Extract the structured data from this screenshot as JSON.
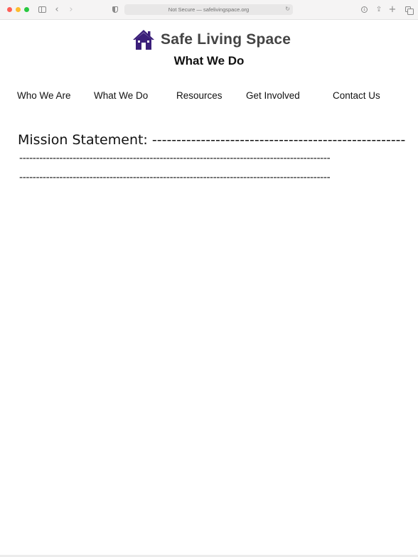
{
  "browser": {
    "address": "Not Secure — safelivingspace.org",
    "back_glyph": "‹",
    "forward_glyph": "›",
    "reload_glyph": "↻",
    "share_glyph": "⇪",
    "new_tab_glyph": "+",
    "download_glyph": "↓"
  },
  "site": {
    "title": "Safe Living Space",
    "brand_color": "#3b1f7a",
    "logo_icon": "house-icon"
  },
  "page": {
    "heading": "What We Do"
  },
  "nav": {
    "items": [
      {
        "label": "Who We Are"
      },
      {
        "label": "What We Do"
      },
      {
        "label": "Resources"
      },
      {
        "label": "Get Involved"
      },
      {
        "label": "Contact Us"
      }
    ]
  },
  "mission": {
    "line1": "Mission Statement: ---------------------------------------------------------",
    "line2": "---------------------------------------------------------------------------------------------",
    "line3": "---------------------------------------------------------------------------------------------"
  }
}
